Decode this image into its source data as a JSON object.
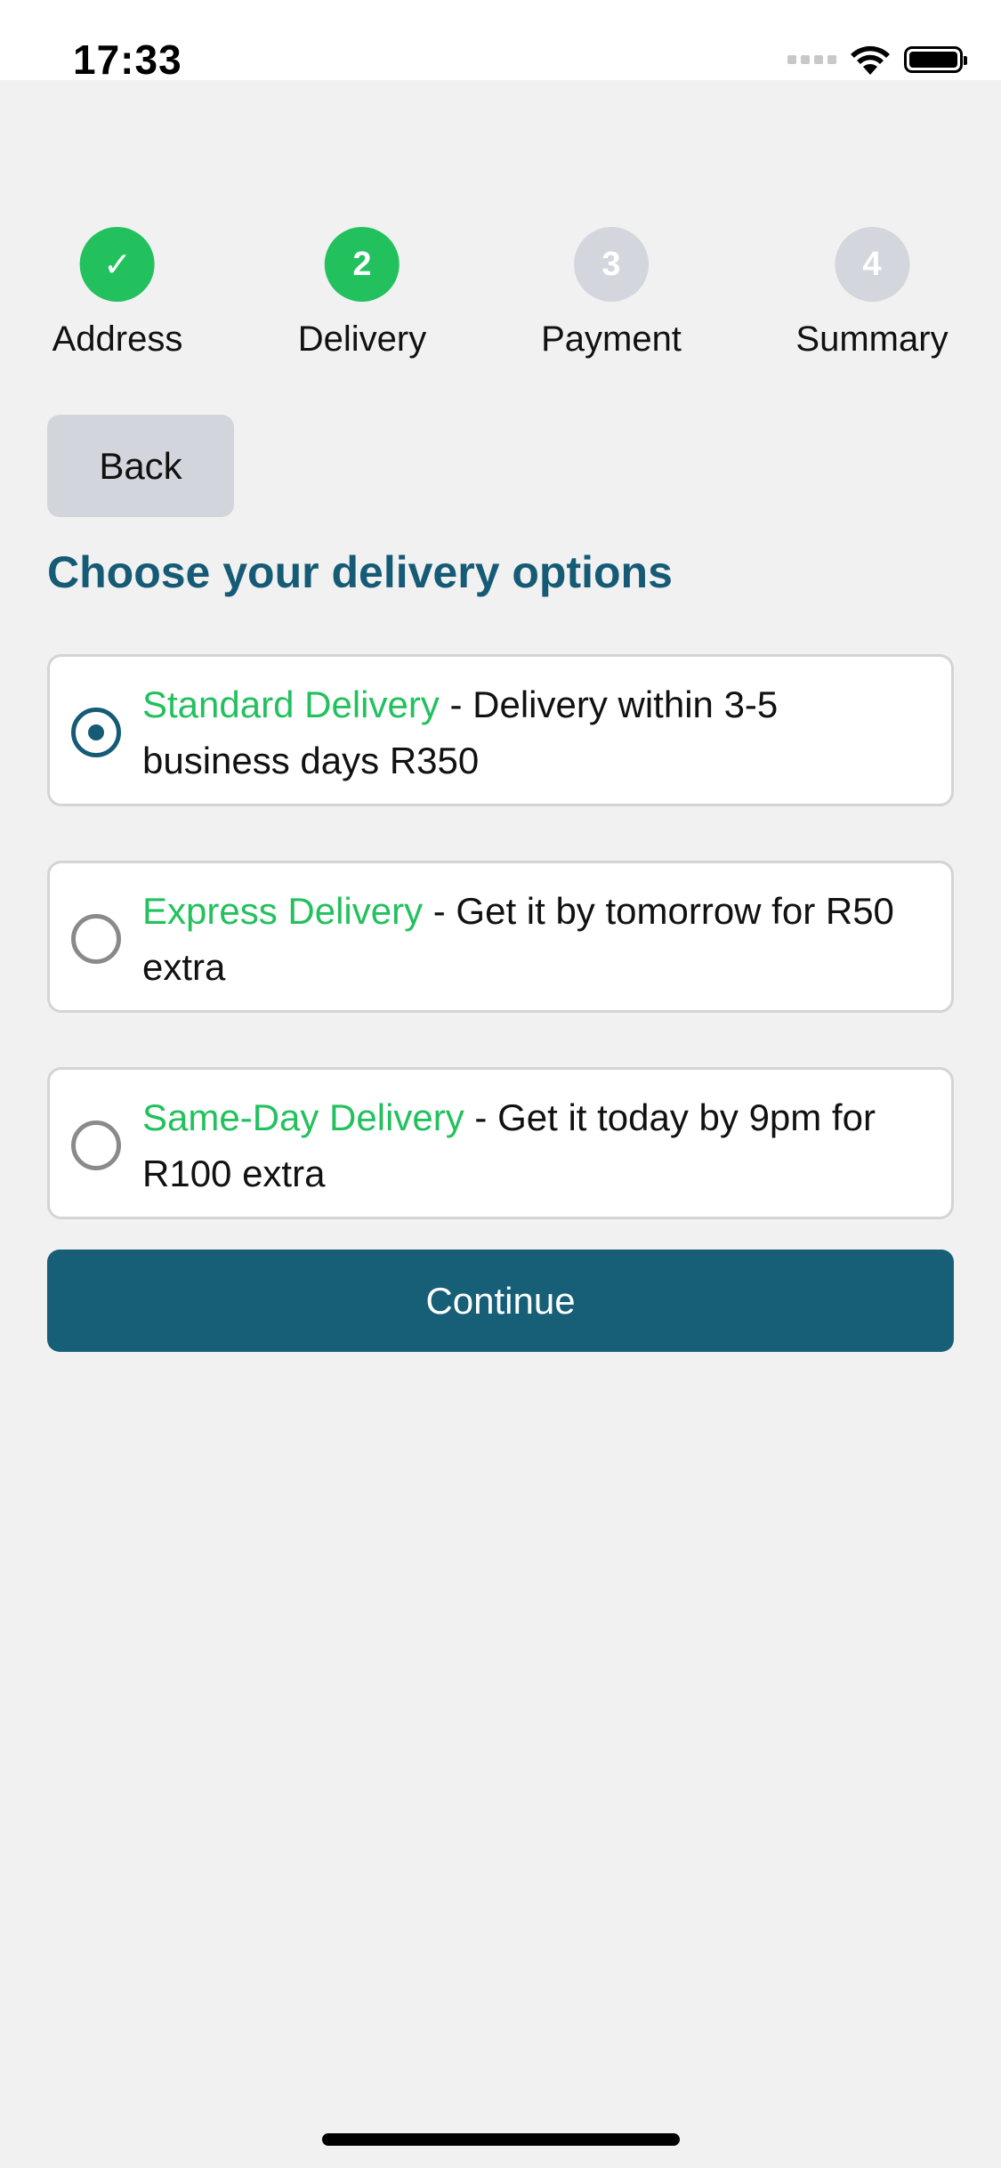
{
  "status_bar": {
    "time": "17:33",
    "wifi_icon": "wifi-icon",
    "battery_icon": "battery-icon"
  },
  "stepper": {
    "steps": [
      {
        "label": "Address",
        "marker": "✓",
        "state": "done"
      },
      {
        "label": "Delivery",
        "marker": "2",
        "state": "active"
      },
      {
        "label": "Payment",
        "marker": "3",
        "state": "pending"
      },
      {
        "label": "Summary",
        "marker": "4",
        "state": "pending"
      }
    ]
  },
  "nav": {
    "back_label": "Back"
  },
  "page": {
    "title": "Choose your delivery options"
  },
  "delivery_options": [
    {
      "name": "Standard Delivery",
      "description": " - Delivery within 3-5 business days R350",
      "selected": true
    },
    {
      "name": "Express Delivery",
      "description": " - Get it by tomorrow for R50 extra",
      "selected": false
    },
    {
      "name": "Same-Day Delivery",
      "description": " - Get it today by 9pm for R100 extra",
      "selected": false
    }
  ],
  "actions": {
    "continue_label": "Continue"
  },
  "colors": {
    "accent_green": "#22c15e",
    "primary_teal": "#165f77",
    "pending_gray": "#d3d6dc",
    "background": "#f1f1f1"
  }
}
